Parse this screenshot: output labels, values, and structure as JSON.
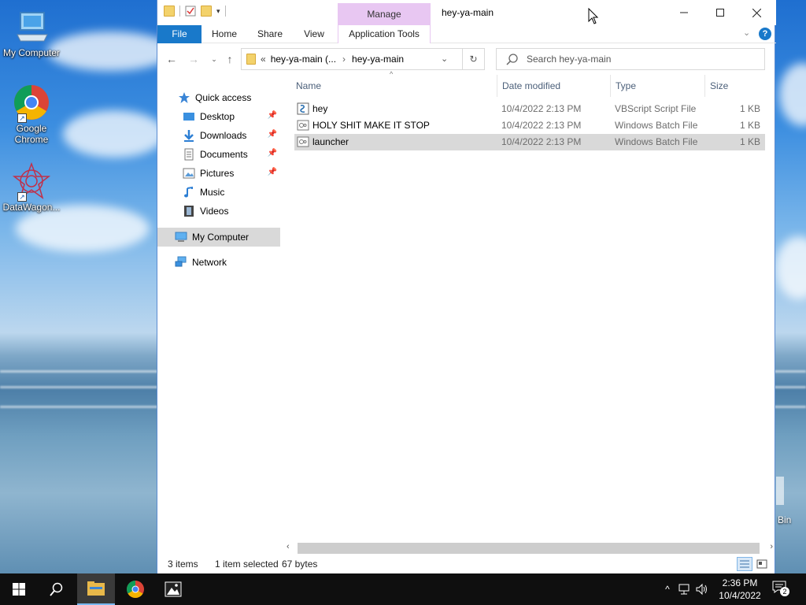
{
  "desktop": {
    "icons": [
      {
        "label": "My Computer"
      },
      {
        "label": "Google Chrome"
      },
      {
        "label": "DataWagon..."
      }
    ],
    "partial_icon_label": "Bin"
  },
  "window": {
    "title": "hey-ya-main",
    "context_tab": "Manage",
    "ribbon_tabs": [
      "File",
      "Home",
      "Share",
      "View",
      "Application Tools"
    ],
    "address": {
      "prefix": "«",
      "crumbs": [
        "hey-ya-main (...",
        "hey-ya-main"
      ]
    },
    "search_placeholder": "Search hey-ya-main",
    "nav": {
      "quick_access": "Quick access",
      "items": [
        "Desktop",
        "Downloads",
        "Documents",
        "Pictures",
        "Music",
        "Videos"
      ],
      "my_computer": "My Computer",
      "network": "Network"
    },
    "columns": [
      "Name",
      "Date modified",
      "Type",
      "Size"
    ],
    "files": [
      {
        "name": "hey",
        "date": "10/4/2022 2:13 PM",
        "type": "VBScript Script File",
        "size": "1 KB",
        "icon": "vbscript-file-icon"
      },
      {
        "name": "HOLY SHIT MAKE IT STOP",
        "date": "10/4/2022 2:13 PM",
        "type": "Windows Batch File",
        "size": "1 KB",
        "icon": "batch-file-icon"
      },
      {
        "name": "launcher",
        "date": "10/4/2022 2:13 PM",
        "type": "Windows Batch File",
        "size": "1 KB",
        "icon": "batch-file-icon",
        "selected": true
      }
    ],
    "status": {
      "items": "3 items",
      "selected": "1 item selected",
      "bytes": "67 bytes"
    }
  },
  "taskbar": {
    "time": "2:36 PM",
    "date": "10/4/2022",
    "notification_count": "2"
  },
  "colors": {
    "accent": "#1979ca",
    "manage_tab": "#e8c7f2",
    "selection": "#d9d9d9",
    "taskbar": "#0f0f0f"
  }
}
